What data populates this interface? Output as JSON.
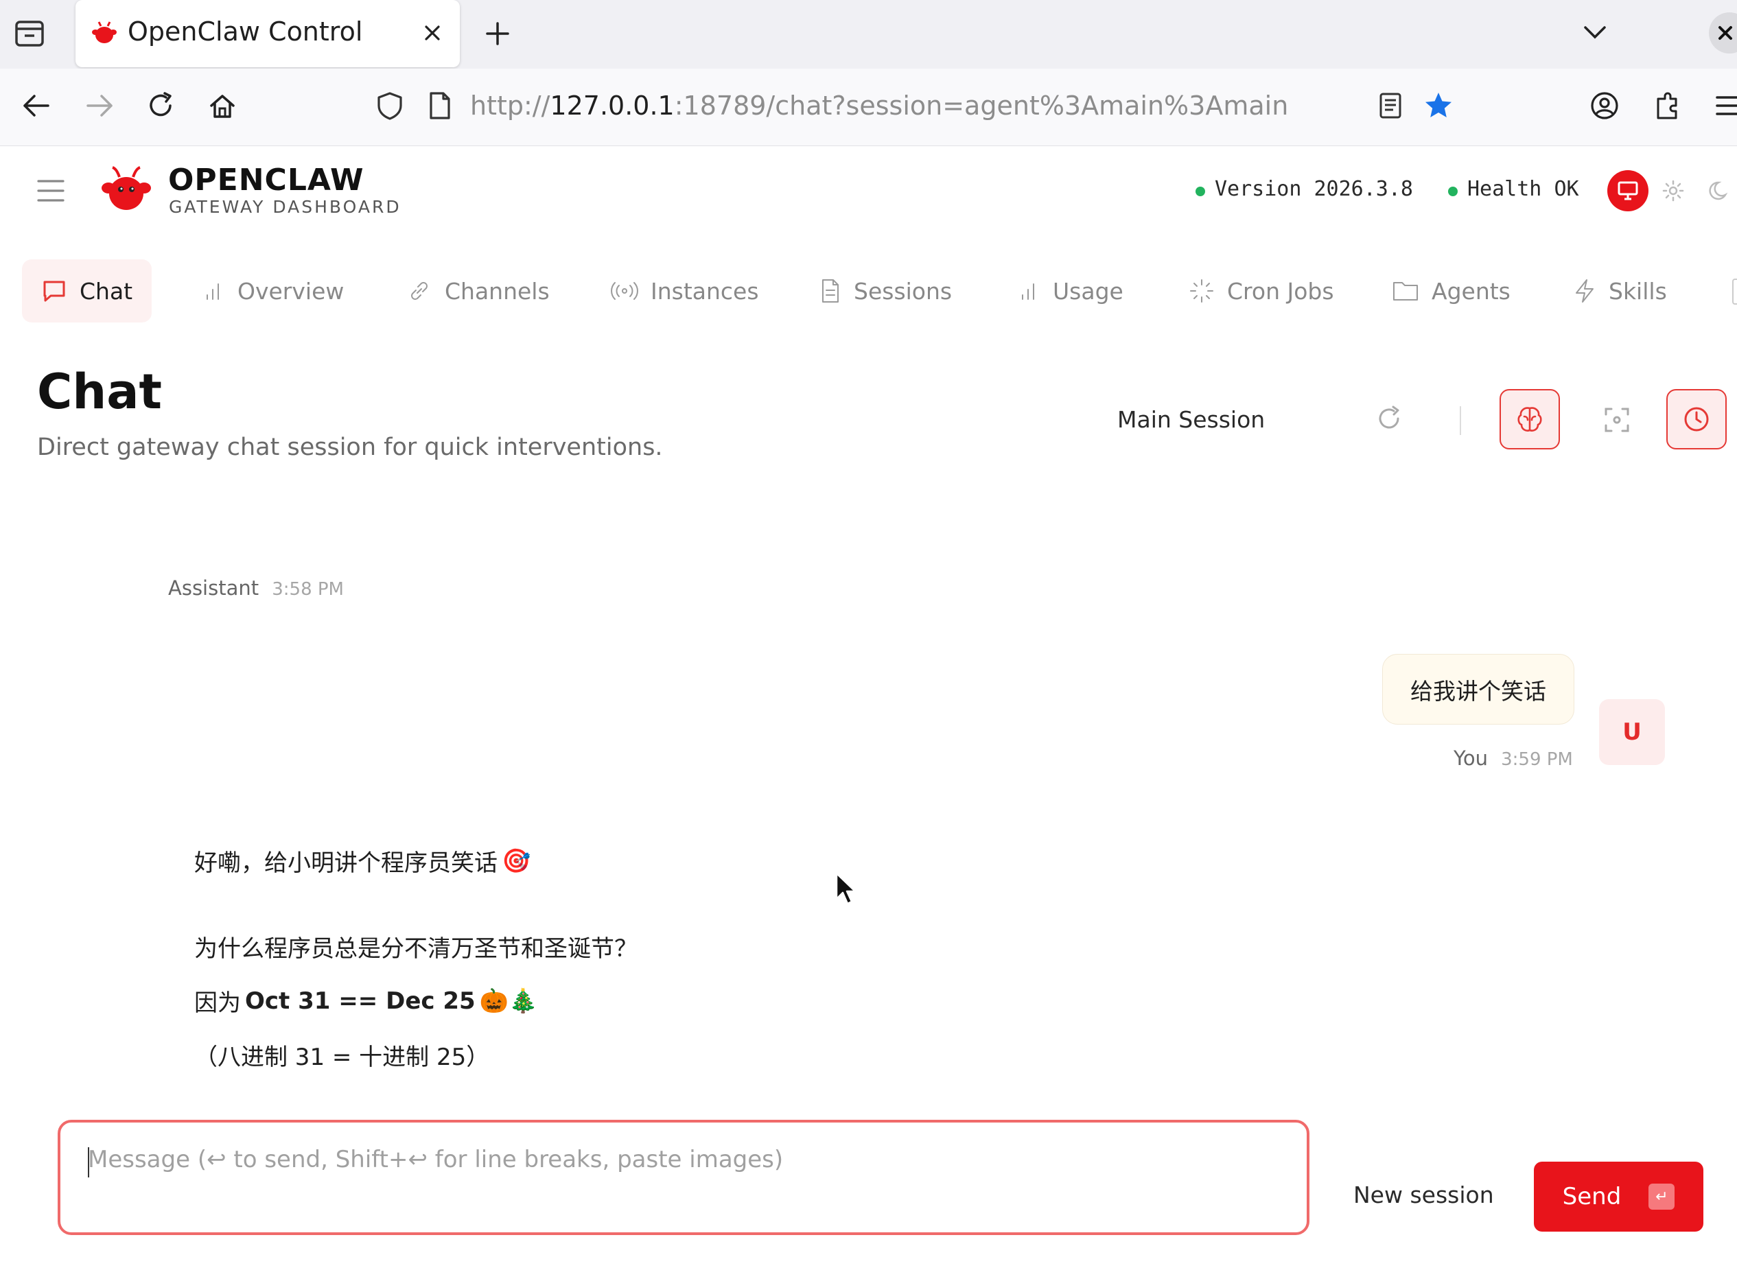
{
  "browser": {
    "tab_title": "OpenClaw Control",
    "url_prefix": "http://",
    "url_host": "127.0.0.1",
    "url_rest": ":18789/chat?session=agent%3Amain%3Amain"
  },
  "header": {
    "brand": "OPENCLAW",
    "subtitle": "GATEWAY DASHBOARD",
    "version_label": "Version",
    "version_value": "2026.3.8",
    "health_label": "Health",
    "health_value": "OK",
    "status_color": "#22b35e",
    "accent_color": "#e8141b"
  },
  "nav": {
    "tabs": [
      {
        "label": "Chat",
        "icon": "chat-bubble-icon",
        "active": true
      },
      {
        "label": "Overview",
        "icon": "bar-chart-icon"
      },
      {
        "label": "Channels",
        "icon": "link-icon"
      },
      {
        "label": "Instances",
        "icon": "radio-icon"
      },
      {
        "label": "Sessions",
        "icon": "document-icon"
      },
      {
        "label": "Usage",
        "icon": "bar-chart-icon"
      },
      {
        "label": "Cron Jobs",
        "icon": "loader-icon"
      },
      {
        "label": "Agents",
        "icon": "folder-icon"
      },
      {
        "label": "Skills",
        "icon": "bolt-icon"
      }
    ]
  },
  "page": {
    "title": "Chat",
    "subtitle": "Direct gateway chat session for quick interventions.",
    "session": "Main Session"
  },
  "messages": {
    "assistant_header": {
      "sender": "Assistant",
      "time": "3:58 PM"
    },
    "user": {
      "text": "给我讲个笑话",
      "sender": "You",
      "time": "3:59 PM",
      "avatar": "U"
    },
    "assistant": {
      "line1": "好嘞，给小明讲个程序员笑话",
      "line1_emoji": "🎯",
      "line2": "为什么程序员总是分不清万圣节和圣诞节？",
      "line3_prefix": "因为",
      "line3_bold": "Oct 31 == Dec 25",
      "line3_emoji": "🎃🎄",
      "line4": "（八进制 31 = 十进制 25）"
    }
  },
  "composer": {
    "placeholder": "Message (↩ to send, Shift+↩ for line breaks, paste images)",
    "value": "",
    "new_session_label": "New session",
    "send_label": "Send",
    "send_key": "↵"
  }
}
